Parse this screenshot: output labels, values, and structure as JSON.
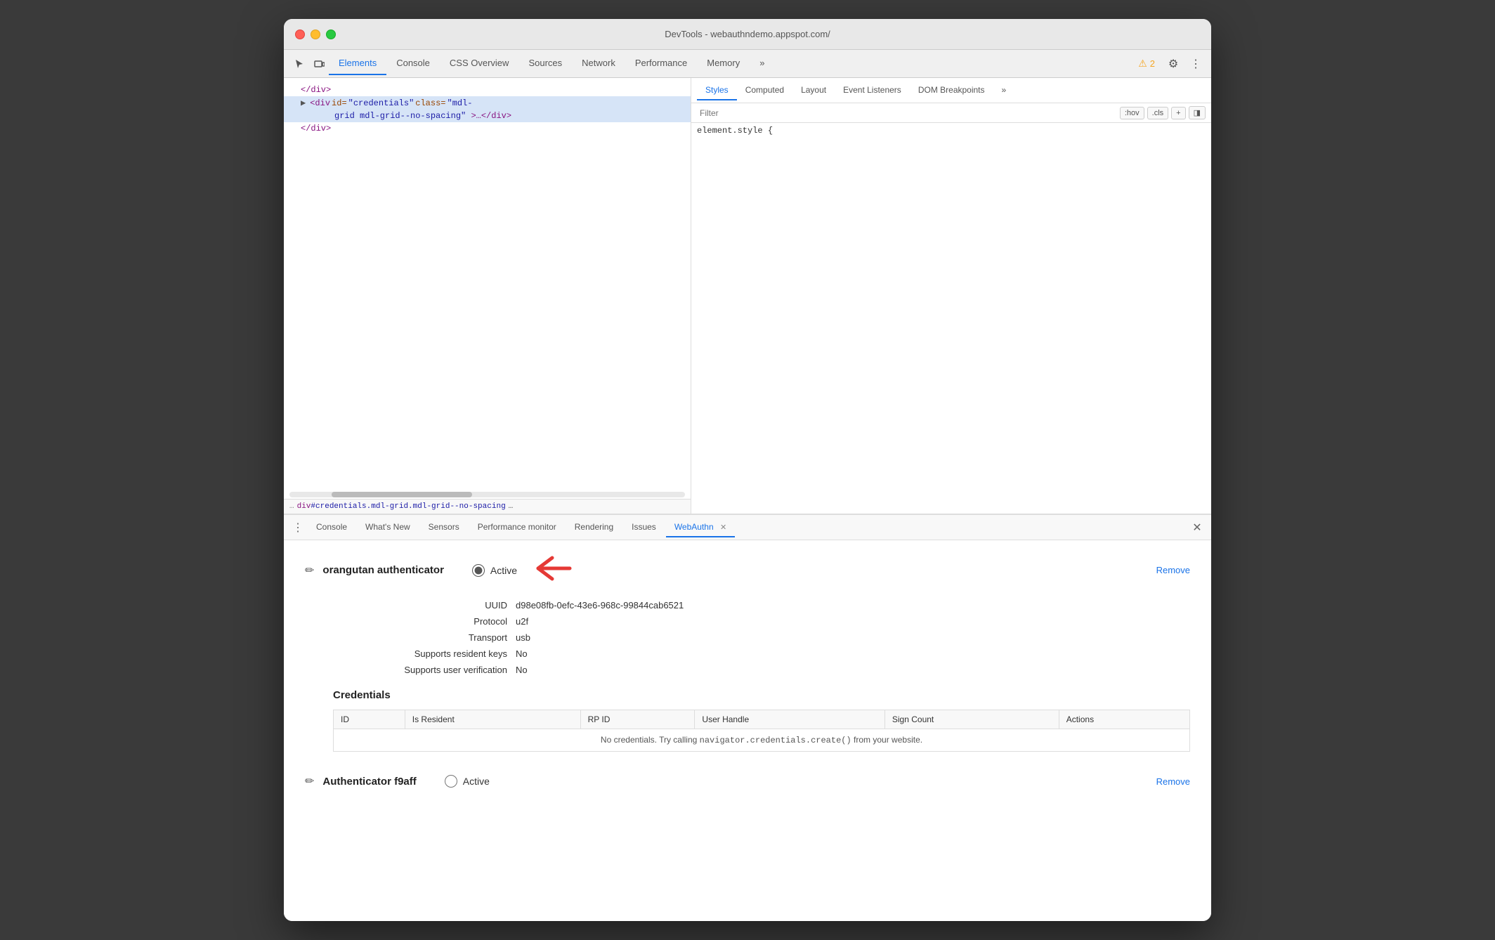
{
  "window": {
    "title": "DevTools - webauthndemo.appspot.com/"
  },
  "traffic_lights": {
    "close": "close",
    "minimize": "minimize",
    "maximize": "maximize"
  },
  "devtools_tabs": {
    "items": [
      {
        "label": "Elements",
        "active": true
      },
      {
        "label": "Console",
        "active": false
      },
      {
        "label": "CSS Overview",
        "active": false
      },
      {
        "label": "Sources",
        "active": false
      },
      {
        "label": "Network",
        "active": false
      },
      {
        "label": "Performance",
        "active": false
      },
      {
        "label": "Memory",
        "active": false
      }
    ],
    "more_icon": "»",
    "warning_count": "2",
    "gear_icon": "⚙",
    "menu_icon": "⋮"
  },
  "elements_panel": {
    "lines": [
      {
        "text": "</div>",
        "indent": 0,
        "selected": false
      },
      {
        "tag": "div",
        "id": "credentials",
        "class": "mdl-grid mdl-grid--no-spacing",
        "selected": true
      },
      {
        "text": "…</div>",
        "indent": 1,
        "selected": false
      },
      {
        "text": "</div>",
        "indent": 0,
        "selected": false
      }
    ],
    "breadcrumb": "div#credentials.mdl-grid.mdl-grid--no-spacing",
    "breadcrumb_dots": "…"
  },
  "styles_panel": {
    "tabs": [
      "Styles",
      "Computed",
      "Layout",
      "Event Listeners",
      "DOM Breakpoints"
    ],
    "active_tab": "Styles",
    "more": "»",
    "filter_placeholder": "Filter",
    "hov_btn": ":hov",
    "cls_btn": ".cls",
    "plus_btn": "+",
    "layout_btn": "◨",
    "style_rule": "element.style {"
  },
  "drawer": {
    "tabs": [
      {
        "label": "Console",
        "active": false,
        "closable": false
      },
      {
        "label": "What's New",
        "active": false,
        "closable": false
      },
      {
        "label": "Sensors",
        "active": false,
        "closable": false
      },
      {
        "label": "Performance monitor",
        "active": false,
        "closable": false
      },
      {
        "label": "Rendering",
        "active": false,
        "closable": false
      },
      {
        "label": "Issues",
        "active": false,
        "closable": false
      },
      {
        "label": "WebAuthn",
        "active": true,
        "closable": true
      }
    ],
    "menu_icon": "⋮",
    "close_icon": "✕"
  },
  "webauthn": {
    "authenticator1": {
      "edit_icon": "✏",
      "name": "orangutan authenticator",
      "active_label": "Active",
      "is_active": true,
      "remove_label": "Remove",
      "uuid_label": "UUID",
      "uuid_value": "d98e08fb-0efc-43e6-968c-99844cab6521",
      "protocol_label": "Protocol",
      "protocol_value": "u2f",
      "transport_label": "Transport",
      "transport_value": "usb",
      "resident_keys_label": "Supports resident keys",
      "resident_keys_value": "No",
      "user_verification_label": "Supports user verification",
      "user_verification_value": "No",
      "credentials_heading": "Credentials",
      "table_columns": [
        "ID",
        "Is Resident",
        "RP ID",
        "User Handle",
        "Sign Count",
        "Actions"
      ],
      "no_creds_message": "No credentials. Try calling ",
      "no_creds_code": "navigator.credentials.create()",
      "no_creds_suffix": " from your website."
    },
    "authenticator2": {
      "edit_icon": "✏",
      "name": "Authenticator f9aff",
      "active_label": "Active",
      "is_active": false,
      "remove_label": "Remove"
    }
  },
  "colors": {
    "link_blue": "#1a73e8",
    "tag_color": "#881280",
    "attr_name_color": "#994500",
    "attr_value_color": "#1a1aa6",
    "active_tab_color": "#1a73e8",
    "arrow_red": "#e53935"
  }
}
